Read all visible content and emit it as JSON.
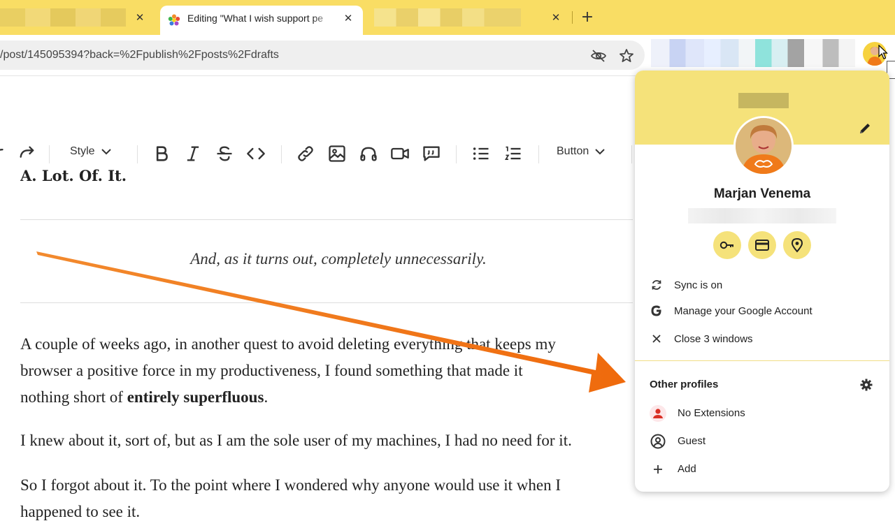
{
  "tabs": {
    "active_title": "Editing \"What I wish support pe",
    "close_glyph": "✕",
    "new_tab_glyph": "+"
  },
  "omnibox": {
    "url": "/post/145095394?back=%2Fpublish%2Fposts%2Fdrafts"
  },
  "editor": {
    "style_label": "Style",
    "button_label": "Button",
    "heading_partial": "A. Lot. Of. It.",
    "quote": "And, as it turns out, completely unnecessarily.",
    "p1_line1": "A couple of weeks ago, in another quest to avoid deleting everything that keeps my",
    "p1_line2": "browser a positive force in my productiveness, I found something that made it",
    "p1_line3_pre": "nothing short of ",
    "p1_line3_bold": "entirely superfluous",
    "p1_line3_post": ".",
    "p2": "I knew about it, sort of, but as I am the sole user of my machines, I had no need for it.",
    "p3_line1": "So I forgot about it. To the point where I wondered why anyone would use it when I",
    "p3_line2": "happened to see it."
  },
  "profile_menu": {
    "name": "Marjan Venema",
    "sync": "Sync is on",
    "manage": "Manage your Google Account",
    "close_windows": "Close 3 windows",
    "other_profiles": "Other profiles",
    "profiles": [
      {
        "label": "No Extensions",
        "icon": "person-icon"
      },
      {
        "label": "Guest",
        "icon": "guest-icon"
      },
      {
        "label": "Add",
        "icon": "plus-icon"
      }
    ]
  },
  "colors": {
    "theme_yellow": "#f9dd64",
    "popup_header": "#f5e27a",
    "arrow_orange": "#f07a1a",
    "profile_red": "#d93025"
  }
}
